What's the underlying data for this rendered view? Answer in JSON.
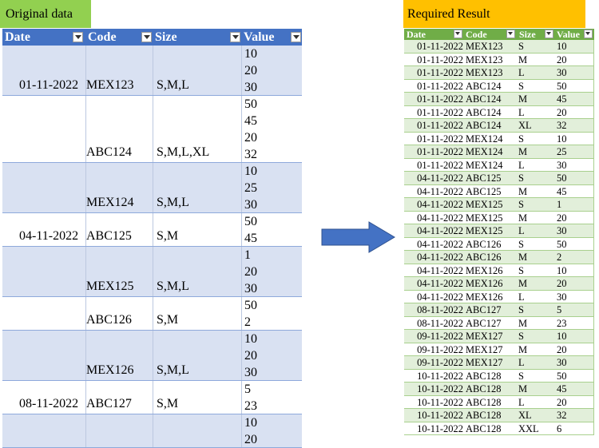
{
  "original": {
    "title": "Original data",
    "headers": {
      "date": "Date",
      "code": "Code",
      "size": "Size",
      "value": "Value"
    },
    "groups": [
      {
        "date": "01-11-2022",
        "code": "MEX123",
        "size": "S,M,L",
        "values": [
          "10",
          "20",
          "30"
        ]
      },
      {
        "date": "",
        "code": "ABC124",
        "size": "S,M,L,XL",
        "values": [
          "50",
          "45",
          "20",
          "32"
        ]
      },
      {
        "date": "",
        "code": "MEX124",
        "size": "S,M,L",
        "values": [
          "10",
          "25",
          "30"
        ]
      },
      {
        "date": "04-11-2022",
        "code": "ABC125",
        "size": "S,M",
        "values": [
          "50",
          "45"
        ]
      },
      {
        "date": "",
        "code": "MEX125",
        "size": "S,M,L",
        "values": [
          "1",
          "20",
          "30"
        ]
      },
      {
        "date": "",
        "code": "ABC126",
        "size": "S,M",
        "values": [
          "50",
          "2"
        ]
      },
      {
        "date": "",
        "code": "MEX126",
        "size": "S,M,L",
        "values": [
          "10",
          "20",
          "30"
        ]
      },
      {
        "date": "08-11-2022",
        "code": "ABC127",
        "size": "S,M",
        "values": [
          "5",
          "23"
        ]
      },
      {
        "date": "",
        "code": "",
        "size": "",
        "values": [
          "10",
          "20"
        ]
      }
    ]
  },
  "result": {
    "title": "Required Result",
    "headers": {
      "date": "Date",
      "code": "Code",
      "size": "Size",
      "value": "Value"
    },
    "rows": [
      [
        "01-11-2022",
        "MEX123",
        "S",
        "10"
      ],
      [
        "01-11-2022",
        "MEX123",
        "M",
        "20"
      ],
      [
        "01-11-2022",
        "MEX123",
        "L",
        "30"
      ],
      [
        "01-11-2022",
        "ABC124",
        "S",
        "50"
      ],
      [
        "01-11-2022",
        "ABC124",
        "M",
        "45"
      ],
      [
        "01-11-2022",
        "ABC124",
        "L",
        "20"
      ],
      [
        "01-11-2022",
        "ABC124",
        "XL",
        "32"
      ],
      [
        "01-11-2022",
        "MEX124",
        "S",
        "10"
      ],
      [
        "01-11-2022",
        "MEX124",
        "M",
        "25"
      ],
      [
        "01-11-2022",
        "MEX124",
        "L",
        "30"
      ],
      [
        "04-11-2022",
        "ABC125",
        "S",
        "50"
      ],
      [
        "04-11-2022",
        "ABC125",
        "M",
        "45"
      ],
      [
        "04-11-2022",
        "MEX125",
        "S",
        "1"
      ],
      [
        "04-11-2022",
        "MEX125",
        "M",
        "20"
      ],
      [
        "04-11-2022",
        "MEX125",
        "L",
        "30"
      ],
      [
        "04-11-2022",
        "ABC126",
        "S",
        "50"
      ],
      [
        "04-11-2022",
        "ABC126",
        "M",
        "2"
      ],
      [
        "04-11-2022",
        "MEX126",
        "S",
        "10"
      ],
      [
        "04-11-2022",
        "MEX126",
        "M",
        "20"
      ],
      [
        "04-11-2022",
        "MEX126",
        "L",
        "30"
      ],
      [
        "08-11-2022",
        "ABC127",
        "S",
        "5"
      ],
      [
        "08-11-2022",
        "ABC127",
        "M",
        "23"
      ],
      [
        "09-11-2022",
        "MEX127",
        "S",
        "10"
      ],
      [
        "09-11-2022",
        "MEX127",
        "M",
        "20"
      ],
      [
        "09-11-2022",
        "MEX127",
        "L",
        "30"
      ],
      [
        "10-11-2022",
        "ABC128",
        "S",
        "50"
      ],
      [
        "10-11-2022",
        "ABC128",
        "M",
        "45"
      ],
      [
        "10-11-2022",
        "ABC128",
        "L",
        "20"
      ],
      [
        "10-11-2022",
        "ABC128",
        "XL",
        "32"
      ],
      [
        "10-11-2022",
        "ABC128",
        " XXL",
        "6"
      ]
    ]
  },
  "colors": {
    "original_title_bg": "#92d050",
    "original_header_bg": "#4472c4",
    "original_band": "#d9e1f2",
    "result_title_bg": "#ffc000",
    "result_header_bg": "#70ad47",
    "result_band": "#e2efda",
    "arrow": "#4472c4"
  },
  "icons": {
    "filter": "filter-dropdown-icon",
    "arrow": "right-arrow-icon"
  }
}
